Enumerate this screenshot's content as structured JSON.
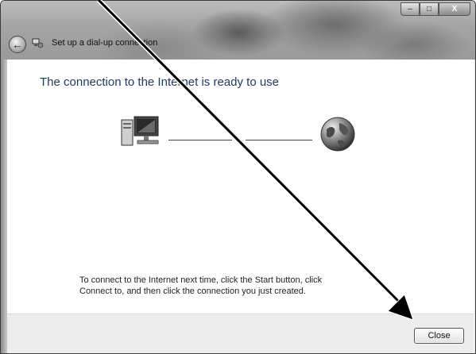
{
  "window": {
    "title": "Set up a dial-up connection",
    "caption_buttons": {
      "minimize": "–",
      "maximize": "□",
      "close": "X"
    }
  },
  "nav": {
    "back_icon": "back-arrow-icon",
    "wizard_icon": "network-connection-icon"
  },
  "content": {
    "heading": "The connection to the Internet is ready to use",
    "computer_icon": "computer-icon",
    "globe_icon": "globe-icon",
    "instructions": "To connect to the Internet next time, click the Start button, click Connect to, and then click the connection you just created."
  },
  "footer": {
    "close_label": "Close"
  },
  "colors": {
    "heading": "#1e3a5c",
    "annotation_arrow": "#000000"
  }
}
